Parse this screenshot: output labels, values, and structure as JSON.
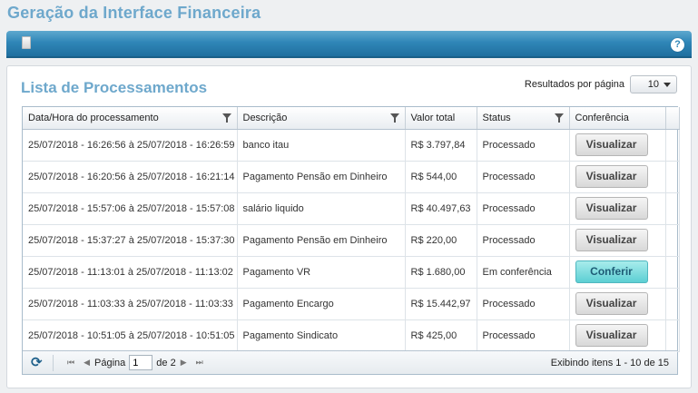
{
  "page": {
    "title": "Geração da Interface Financeira"
  },
  "toolbar": {
    "help_label": "?"
  },
  "panel": {
    "title": "Lista de Processamentos",
    "per_page_label": "Resultados por página",
    "per_page_value": "10"
  },
  "table": {
    "columns": [
      "Data/Hora do processamento",
      "Descrição",
      "Valor total",
      "Status",
      "Conferência"
    ],
    "rows": [
      {
        "datetime": "25/07/2018 - 16:26:56 à 25/07/2018 - 16:26:59",
        "description": "banco itau",
        "value": "R$ 3.797,84",
        "status": "Processado",
        "action": "Visualizar"
      },
      {
        "datetime": "25/07/2018 - 16:20:56 à 25/07/2018 - 16:21:14",
        "description": "Pagamento Pensão em Dinheiro",
        "value": "R$ 544,00",
        "status": "Processado",
        "action": "Visualizar"
      },
      {
        "datetime": "25/07/2018 - 15:57:06 à 25/07/2018 - 15:57:08",
        "description": "salário liquido",
        "value": "R$ 40.497,63",
        "status": "Processado",
        "action": "Visualizar"
      },
      {
        "datetime": "25/07/2018 - 15:37:27 à 25/07/2018 - 15:37:30",
        "description": "Pagamento Pensão em Dinheiro",
        "value": "R$ 220,00",
        "status": "Processado",
        "action": "Visualizar"
      },
      {
        "datetime": "25/07/2018 - 11:13:01 à 25/07/2018 - 11:13:02",
        "description": "Pagamento VR",
        "value": "R$ 1.680,00",
        "status": "Em conferência",
        "action": "Conferir"
      },
      {
        "datetime": "25/07/2018 - 11:03:33 à 25/07/2018 - 11:03:33",
        "description": "Pagamento Encargo",
        "value": "R$ 15.442,97",
        "status": "Processado",
        "action": "Visualizar"
      },
      {
        "datetime": "25/07/2018 - 10:51:05 à 25/07/2018 - 10:51:05",
        "description": "Pagamento Sindicato",
        "value": "R$ 425,00",
        "status": "Processado",
        "action": "Visualizar"
      }
    ]
  },
  "pager": {
    "page_label": "Página",
    "current_page": "1",
    "of_label": "de 2",
    "info": "Exibindo itens 1 - 10 de 15"
  },
  "colors": {
    "title": "#6ea8cc",
    "toolbar": "#2f86b7",
    "primary_button": "#5ccfd3"
  }
}
